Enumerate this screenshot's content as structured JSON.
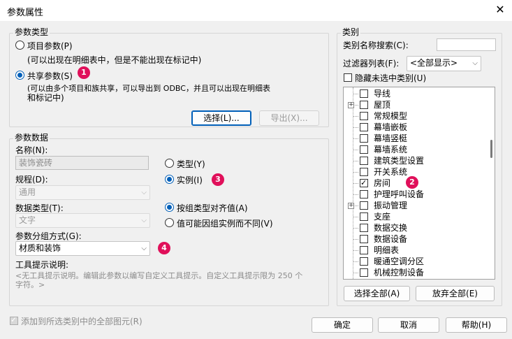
{
  "window": {
    "title": "参数属性",
    "close_glyph": "✕"
  },
  "param_type": {
    "legend": "参数类型",
    "project_param": "项目参数(P)",
    "project_desc": "(可以出现在明细表中，但是不能出现在标记中)",
    "shared_param": "共享参数(S)",
    "shared_desc_1": "(可以由多个项目和族共享，可以导出到 ODBC，并且可以出现在明细表",
    "shared_desc_2": "和标记中)",
    "select_button": "选择(L)...",
    "export_button": "导出(X)...",
    "selected": "shared"
  },
  "param_data": {
    "legend": "参数数据",
    "name_label": "名称(N):",
    "name_value": "装饰瓷砖",
    "discipline_label": "规程(D):",
    "discipline_value": "通用",
    "datatype_label": "数据类型(T):",
    "datatype_value": "文字",
    "group_label": "参数分组方式(G):",
    "group_value": "材质和装饰",
    "tooltip_label": "工具提示说明:",
    "tooltip_text_1": "<无工具提示说明。编辑此参数以编写自定义工具提示。自定义工具提示限为 250 个",
    "tooltip_text_2": "字符。>",
    "type_radio": "类型(Y)",
    "instance_radio": "实例(I)",
    "align_by_group": "按组类型对齐值(A)",
    "vary_by_instance": "值可能因组实例而不同(V)"
  },
  "category": {
    "legend": "类别",
    "search_label": "类别名称搜索(C):",
    "search_value": "",
    "filter_label": "过滤器列表(F):",
    "filter_value": "<全部显示>",
    "hide_unchecked": "隐藏未选中类别(U)",
    "items": [
      {
        "label": "导线",
        "checked": false,
        "expandable": false
      },
      {
        "label": "屋顶",
        "checked": false,
        "expandable": true
      },
      {
        "label": "常规模型",
        "checked": false,
        "expandable": false
      },
      {
        "label": "幕墙嵌板",
        "checked": false,
        "expandable": false
      },
      {
        "label": "幕墙竖梃",
        "checked": false,
        "expandable": false
      },
      {
        "label": "幕墙系统",
        "checked": false,
        "expandable": false
      },
      {
        "label": "建筑类型设置",
        "checked": false,
        "expandable": false
      },
      {
        "label": "开关系统",
        "checked": false,
        "expandable": false
      },
      {
        "label": "房间",
        "checked": true,
        "expandable": false
      },
      {
        "label": "护理呼叫设备",
        "checked": false,
        "expandable": false
      },
      {
        "label": "振动管理",
        "checked": false,
        "expandable": true
      },
      {
        "label": "支座",
        "checked": false,
        "expandable": false
      },
      {
        "label": "数据交换",
        "checked": false,
        "expandable": false
      },
      {
        "label": "数据设备",
        "checked": false,
        "expandable": false
      },
      {
        "label": "明细表",
        "checked": false,
        "expandable": false
      },
      {
        "label": "暖通空调分区",
        "checked": false,
        "expandable": false
      },
      {
        "label": "机械控制设备",
        "checked": false,
        "expandable": false
      }
    ],
    "select_all": "选择全部(A)",
    "deselect_all": "放弃全部(E)"
  },
  "footer": {
    "add_to_all": "添加到所选类别中的全部图元(R)",
    "ok": "确定",
    "cancel": "取消",
    "help": "帮助(H)"
  },
  "badges": [
    "1",
    "2",
    "3",
    "4"
  ],
  "colors": {
    "accent": "#005fb8",
    "badge": "#e0105a"
  }
}
